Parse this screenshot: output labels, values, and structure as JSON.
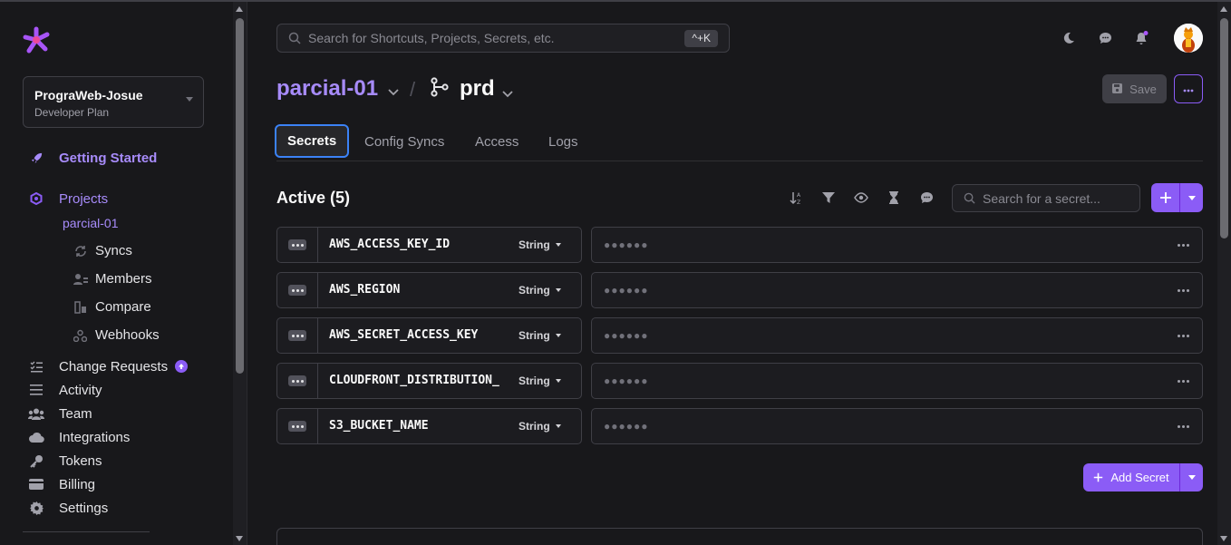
{
  "app": {
    "workspace_name": "PrograWeb-Josue",
    "workspace_plan": "Developer Plan",
    "search_placeholder": "Search for Shortcuts, Projects, Secrets, etc.",
    "search_shortcut": "^+K",
    "accent_color": "#8b5cf6"
  },
  "sidebar": {
    "getting_started": "Getting Started",
    "projects": "Projects",
    "current_project": "parcial-01",
    "project_subitems": [
      {
        "label": "Syncs",
        "icon": "sync-icon"
      },
      {
        "label": "Members",
        "icon": "members-icon"
      },
      {
        "label": "Compare",
        "icon": "compare-icon"
      },
      {
        "label": "Webhooks",
        "icon": "webhooks-icon"
      }
    ],
    "items": [
      {
        "label": "Change Requests",
        "icon": "change-requests-icon"
      },
      {
        "label": "Activity",
        "icon": "activity-icon"
      },
      {
        "label": "Team",
        "icon": "team-icon"
      },
      {
        "label": "Integrations",
        "icon": "integrations-icon"
      },
      {
        "label": "Tokens",
        "icon": "key-icon"
      },
      {
        "label": "Billing",
        "icon": "billing-icon"
      },
      {
        "label": "Settings",
        "icon": "gear-icon"
      }
    ]
  },
  "header": {
    "project": "parcial-01",
    "separator": "/",
    "environment": "prd",
    "save_label": "Save"
  },
  "tabs": [
    "Secrets",
    "Config Syncs",
    "Access",
    "Logs"
  ],
  "secrets": {
    "title": "Active (5)",
    "search_placeholder": "Search for a secret...",
    "add_label": "Add Secret",
    "rows": [
      {
        "name": "AWS_ACCESS_KEY_ID",
        "type": "String",
        "value": "●●●●●●"
      },
      {
        "name": "AWS_REGION",
        "type": "String",
        "value": "●●●●●●"
      },
      {
        "name": "AWS_SECRET_ACCESS_KEY",
        "type": "String",
        "value": "●●●●●●"
      },
      {
        "name": "CLOUDFRONT_DISTRIBUTION_",
        "type": "String",
        "value": "●●●●●●"
      },
      {
        "name": "S3_BUCKET_NAME",
        "type": "String",
        "value": "●●●●●●"
      }
    ]
  }
}
